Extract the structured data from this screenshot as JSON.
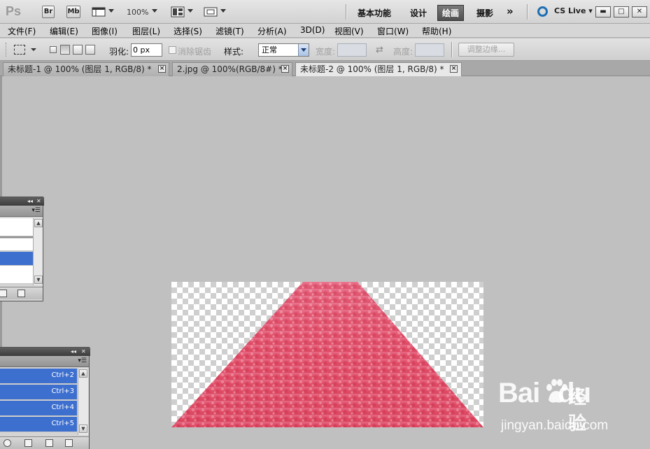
{
  "app": {
    "logo": "Ps",
    "bridge_label": "Br",
    "minibridge_label": "Mb",
    "zoom_level": "100%",
    "workspaces": [
      "基本功能",
      "设计",
      "绘画",
      "摄影"
    ],
    "active_workspace": "绘画",
    "more_label": "»",
    "cs_live": "CS Live ▾",
    "window_buttons": [
      "▬",
      "□",
      "✕"
    ]
  },
  "menu": [
    "文件(F)",
    "编辑(E)",
    "图像(I)",
    "图层(L)",
    "选择(S)",
    "滤镜(T)",
    "分析(A)",
    "3D(D)",
    "视图(V)",
    "窗口(W)",
    "帮助(H)"
  ],
  "options": {
    "feather_label": "羽化:",
    "feather_value": "0 px",
    "antialias_label": "消除锯齿",
    "style_label": "样式:",
    "style_value": "正常",
    "width_label": "宽度:",
    "height_label": "高度:",
    "refine_edge_label": "调整边缘..."
  },
  "tabs": [
    {
      "label": "未标题-1 @ 100% (图层 1, RGB/8) *"
    },
    {
      "label": "2.jpg @ 100%(RGB/8#) *"
    },
    {
      "label": "未标题-2 @ 100% (图层 1, RGB/8) *"
    }
  ],
  "active_tab_index": 2,
  "panels": {
    "history_top": {
      "title_buttons": [
        "◂◂",
        "✕"
      ]
    },
    "channels": {
      "title_buttons": [
        "◂◂",
        "✕"
      ],
      "rows": [
        {
          "shortcut": "Ctrl+2"
        },
        {
          "shortcut": "Ctrl+3"
        },
        {
          "shortcut": "Ctrl+4"
        },
        {
          "shortcut": "Ctrl+5"
        }
      ]
    }
  },
  "watermark": {
    "brand": "Bai",
    "brand2": "du",
    "product": "经验",
    "url": "jingyan.baidu.com"
  },
  "colors": {
    "accent_selection": "#3d6fcf",
    "road_pink": "#e8506a"
  }
}
